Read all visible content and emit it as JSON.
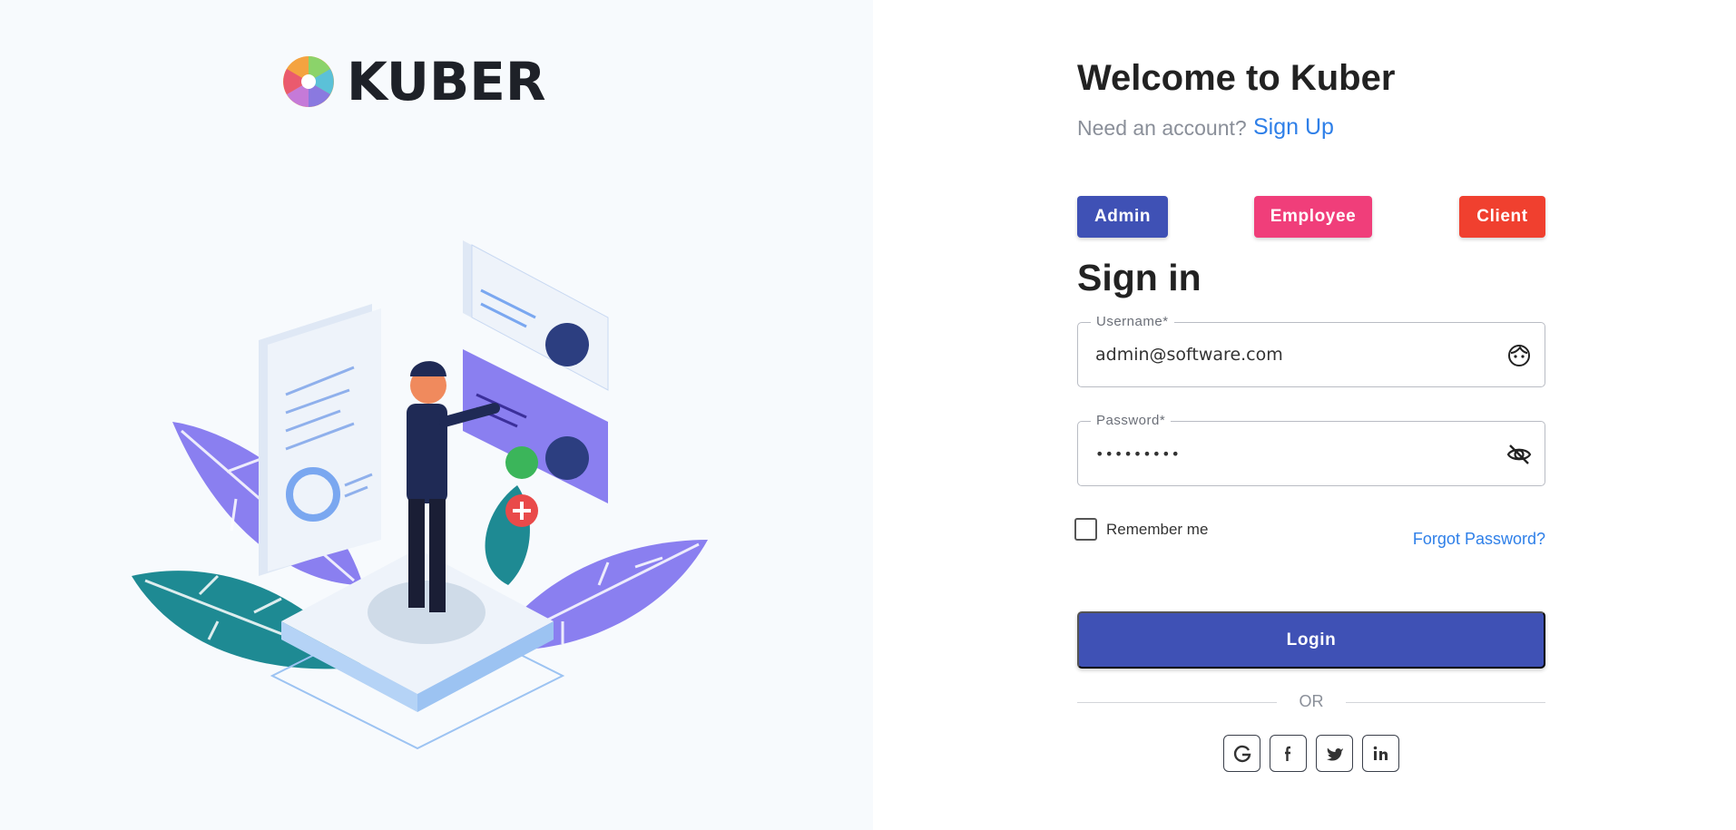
{
  "brand": {
    "name": "KUBER"
  },
  "header": {
    "title": "Welcome to Kuber",
    "need_account": "Need an account?",
    "signup_link": "Sign Up"
  },
  "roles": [
    {
      "label": "Admin",
      "color": "#3f51b5"
    },
    {
      "label": "Employee",
      "color": "#f03e7a"
    },
    {
      "label": "Client",
      "color": "#f0402f"
    }
  ],
  "form": {
    "heading": "Sign in",
    "username": {
      "label": "Username*",
      "value": "admin@software.com",
      "icon": "face-icon"
    },
    "password": {
      "label": "Password*",
      "value": "•••••••••",
      "icon": "eye-off-icon"
    },
    "remember_label": "Remember me",
    "remember_checked": false,
    "forgot_link": "Forgot Password?",
    "login_label": "Login",
    "or_text": "OR"
  },
  "social": [
    {
      "icon": "google-icon"
    },
    {
      "icon": "facebook-icon"
    },
    {
      "icon": "twitter-icon"
    },
    {
      "icon": "linkedin-icon"
    }
  ],
  "colors": {
    "primary": "#3f51b5",
    "link": "#2e7fe8",
    "left_bg": "#f7fafd"
  }
}
